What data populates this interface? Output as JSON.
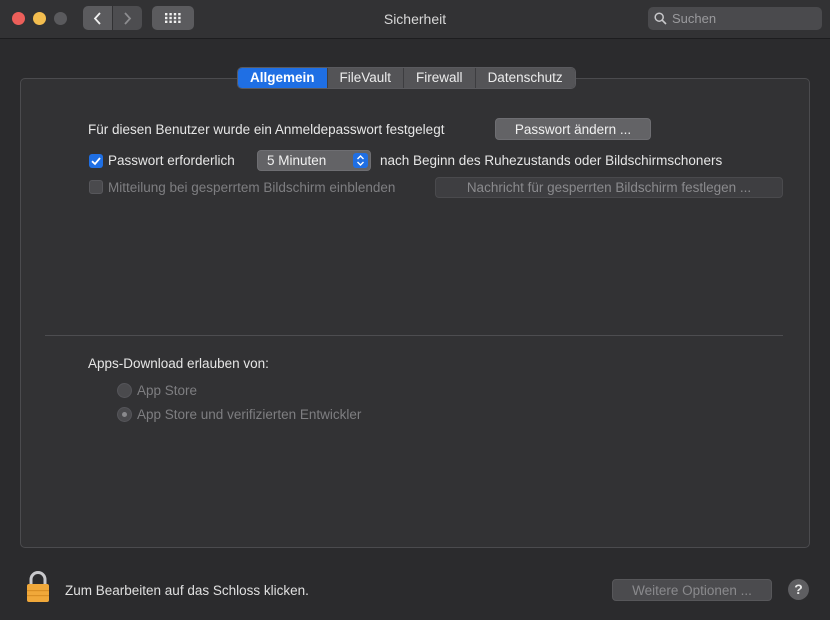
{
  "window": {
    "title": "Sicherheit"
  },
  "search": {
    "placeholder": "Suchen"
  },
  "tabs": [
    "Allgemein",
    "FileVault",
    "Firewall",
    "Datenschutz"
  ],
  "general": {
    "password_set_text": "Für diesen Benutzer wurde ein Anmeldepasswort festgelegt",
    "change_password_button": "Passwort ändern ...",
    "require_password_label": "Passwort erforderlich",
    "require_password_checked": true,
    "require_password_delay": "5 Minuten",
    "require_password_suffix": "nach Beginn des Ruhezustands oder Bildschirmschoners",
    "lock_message_label": "Mitteilung bei gesperrtem Bildschirm einblenden",
    "lock_message_checked": false,
    "lock_message_button": "Nachricht für gesperrten Bildschirm festlegen ..."
  },
  "downloads": {
    "heading": "Apps-Download erlauben von:",
    "options": [
      "App Store",
      "App Store und verifizierten Entwickler"
    ],
    "selected_index": 1
  },
  "footer": {
    "lock_text": "Zum Bearbeiten auf das Schloss klicken.",
    "advanced_button": "Weitere Optionen ...",
    "help_label": "?"
  },
  "colors": {
    "accent": "#1f6fe4",
    "background": "#2b2b2d",
    "lock": "#f0a83a"
  }
}
